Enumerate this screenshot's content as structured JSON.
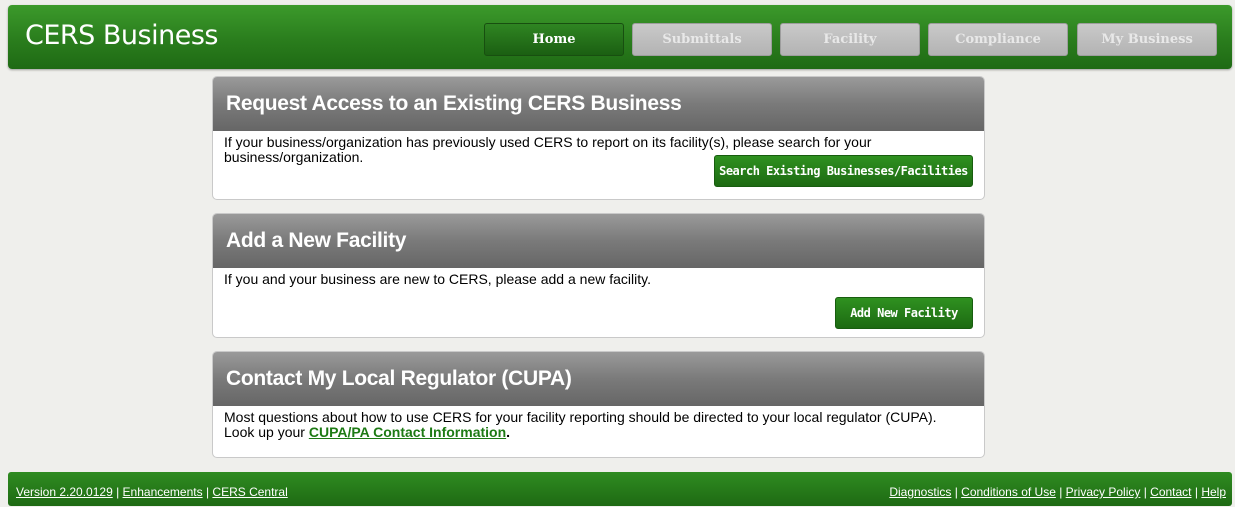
{
  "header": {
    "brand": "CERS Business",
    "nav": [
      {
        "label": "Home",
        "active": true
      },
      {
        "label": "Submittals",
        "active": false
      },
      {
        "label": "Facility",
        "active": false
      },
      {
        "label": "Compliance",
        "active": false
      },
      {
        "label": "My Business",
        "active": false
      }
    ]
  },
  "panels": {
    "request": {
      "title": "Request Access to an Existing CERS Business",
      "text": "If your business/organization has previously used CERS to report on its facility(s), please search for your business/organization.",
      "button": "Search Existing Businesses/Facilities"
    },
    "add": {
      "title": "Add a New Facility",
      "text": "If you and your business are new to CERS, please add a new facility.",
      "button": "Add New Facility"
    },
    "contact": {
      "title": "Contact My Local Regulator (CUPA)",
      "text_before": "Most questions about how to use CERS for your facility reporting should be directed to your local regulator (CUPA). Look up your ",
      "link": "CUPA/PA Contact Information",
      "text_after": "."
    }
  },
  "footer": {
    "version": "Version 2.20.0129",
    "enhancements": "Enhancements",
    "cers_central": "CERS Central",
    "separator": " | ",
    "diagnostics": "Diagnostics",
    "conditions": "Conditions of Use",
    "privacy": "Privacy Policy",
    "contact": "Contact",
    "help": "Help"
  },
  "colors": {
    "brand_green": "#2a7d1d",
    "panel_header_gray": "#7a7a7a",
    "disabled_nav": "#b3b3b3"
  }
}
